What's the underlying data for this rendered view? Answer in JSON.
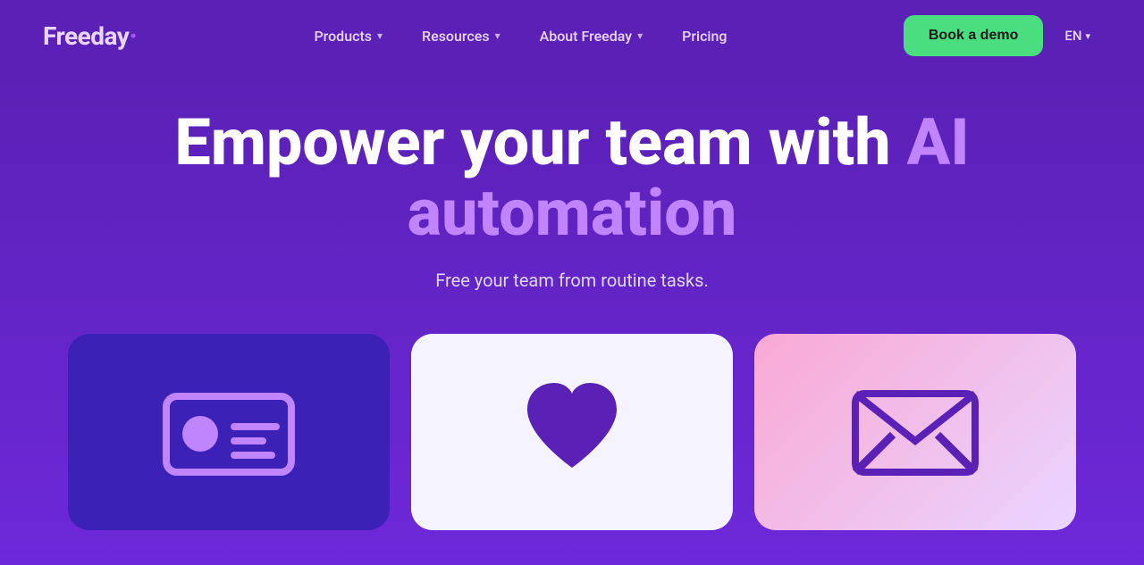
{
  "logo": {
    "text": "Freeday",
    "dot": "·"
  },
  "nav": {
    "links": [
      {
        "label": "Products",
        "has_chevron": true
      },
      {
        "label": "Resources",
        "has_chevron": true
      },
      {
        "label": "About Freeday",
        "has_chevron": true
      },
      {
        "label": "Pricing",
        "has_chevron": false
      }
    ],
    "book_demo": "Book a demo",
    "lang": "EN"
  },
  "hero": {
    "title_part1": "Empower your team with ",
    "title_ai": "AI",
    "title_part2": "automation",
    "subtitle": "Free your team from routine tasks.",
    "cards": [
      {
        "type": "id-card",
        "bg": "dark-purple"
      },
      {
        "type": "heart",
        "bg": "white"
      },
      {
        "type": "mail",
        "bg": "pink"
      }
    ]
  },
  "colors": {
    "bg_main": "#6d28d9",
    "bg_nav": "#5b21b6",
    "accent_green": "#4ade80",
    "accent_purple_light": "#c084fc",
    "card_dark": "#3b21b6",
    "card_white": "#f5f3ff",
    "card_pink_start": "#f9a8d4",
    "card_pink_end": "#e9d5ff"
  }
}
